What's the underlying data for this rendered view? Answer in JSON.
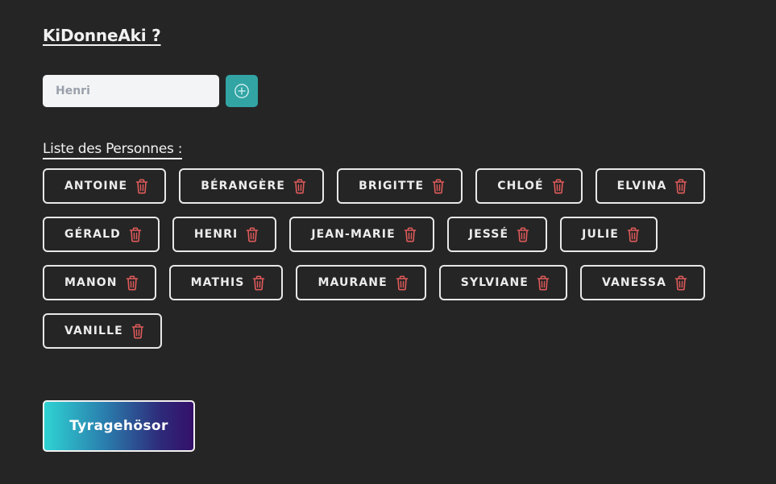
{
  "app": {
    "title": "KiDonneAki ?"
  },
  "add_form": {
    "input_value": "",
    "input_placeholder": "Henri",
    "add_icon": "plus-circle-icon"
  },
  "list": {
    "label": "Liste des Personnes :",
    "delete_icon": "trash-icon",
    "items": [
      {
        "label": "ANTOINE"
      },
      {
        "label": "BÉRANGÈRE"
      },
      {
        "label": "BRIGITTE"
      },
      {
        "label": "CHLOÉ"
      },
      {
        "label": "ELVINA"
      },
      {
        "label": "GÉRALD"
      },
      {
        "label": "HENRI"
      },
      {
        "label": "JEAN-MARIE"
      },
      {
        "label": "JESSÉ"
      },
      {
        "label": "JULIE"
      },
      {
        "label": "MANON"
      },
      {
        "label": "MATHIS"
      },
      {
        "label": "MAURANE"
      },
      {
        "label": "SYLVIANE"
      },
      {
        "label": "VANESSA"
      },
      {
        "label": "VANILLE"
      }
    ]
  },
  "draw_button": {
    "label": "Tyragehösor"
  },
  "colors": {
    "background": "#252525",
    "accent": "#32a4a4",
    "delete": "#e05a5a",
    "gradient_start": "#2ed3d3",
    "gradient_end": "#34106a"
  }
}
